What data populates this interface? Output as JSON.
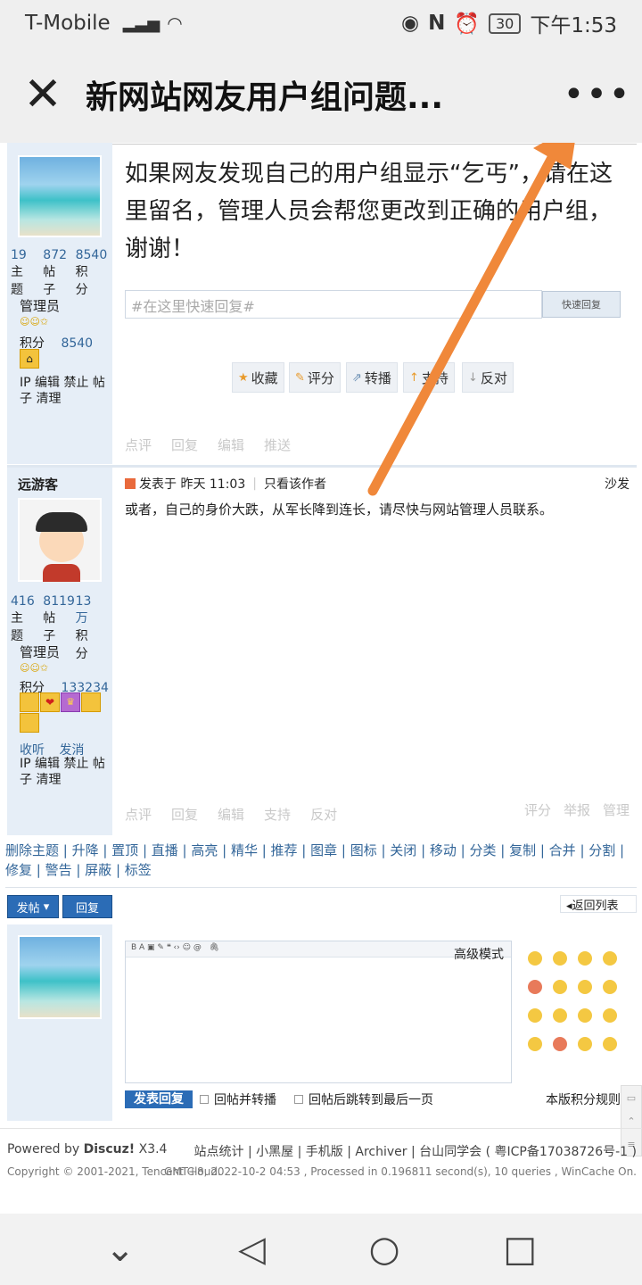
{
  "status": {
    "carrier": "T-Mobile",
    "battery": "30",
    "time": "下午1:53"
  },
  "titlebar": {
    "close_icon": "close-icon",
    "title": "新网站网友用户组问题...",
    "more_icon": "more-dots-icon"
  },
  "post1": {
    "body": "如果网友发现自己的用户组显示“乞丐”，请在这里留名，管理人员会帮您更改到正确的用户组，谢谢！",
    "stats": {
      "v1": "19",
      "v2": "872",
      "v3": "8540",
      "l1": "主题",
      "l2": "帖子",
      "l3": "积分"
    },
    "group": "管理员",
    "points_label": "积分",
    "points": "8540",
    "mod_links": "IP 编辑 禁止 帖子 清理",
    "quick_reply_placeholder": "#在这里快速回复#",
    "quick_reply_btn": "快速回复",
    "btn_fav": "收藏",
    "btn_rate": "评分",
    "btn_share": "转播",
    "btn_support": "支持",
    "btn_oppose": "反对",
    "act_comment": "点评",
    "act_reply": "回复",
    "act_edit": "编辑",
    "act_push": "推送"
  },
  "post2": {
    "author": "远游客",
    "posted": "发表于 昨天 11:03",
    "only_author": "只看该作者",
    "floor": "沙发",
    "body": "或者，自己的身价大跌，从军长降到连长，请尽快与网站管理人员联系。",
    "stats": {
      "v1": "416",
      "v2": "8119",
      "v3": "13万",
      "l1": "主题",
      "l2": "帖子",
      "l3": "积分"
    },
    "group": "管理员",
    "points_label": "积分",
    "points": "133234",
    "listen": "收听",
    "msg": "发消",
    "mod_links": "IP 编辑 禁止 帖子 清理",
    "act_comment": "点评",
    "act_reply": "回复",
    "act_edit": "编辑",
    "act_support": "支持",
    "act_oppose": "反对",
    "act_rate": "评分",
    "act_report": "举报",
    "act_manage": "管理"
  },
  "modbar": "删除主题 | 升降 | 置顶 | 直播 | 高亮 | 精华 | 推荐 | 图章 | 图标 | 关闭 | 移动 | 分类 | 复制 | 合并 | 分割 | 修复 | 警告 | 屏蔽 | 标签",
  "bottombar": {
    "post": "发帖",
    "reply": "回复",
    "back": "返回列表"
  },
  "editor": {
    "advanced": "高级模式",
    "submit": "发表回复",
    "opt1": "回帖并转播",
    "opt2": "回帖后跳转到最后一页",
    "rules": "本版积分规则"
  },
  "footer": {
    "powered_prefix": "Powered by ",
    "powered_brand": "Discuz!",
    "powered_ver": " X3.4",
    "links": "站点统计 | 小黑屋 | 手机版 | Archiver | 台山同学会 ( 粤ICP备17038726号-1 )",
    "copyright": "Copyright © 2001-2021, Tencent Cloud.",
    "gmt": "GMT+8, 2022-10-2 04:53 , Processed in 0.196811 second(s), 10 queries , WinCache On."
  },
  "nav": {
    "back_icon": "back-triangle-icon",
    "home_icon": "home-circle-icon",
    "recent_icon": "recent-square-icon",
    "down_icon": "chevron-down-icon"
  },
  "colors": {
    "accent": "#336699",
    "arrow": "#f0883a",
    "submit": "#2b6cb6"
  }
}
